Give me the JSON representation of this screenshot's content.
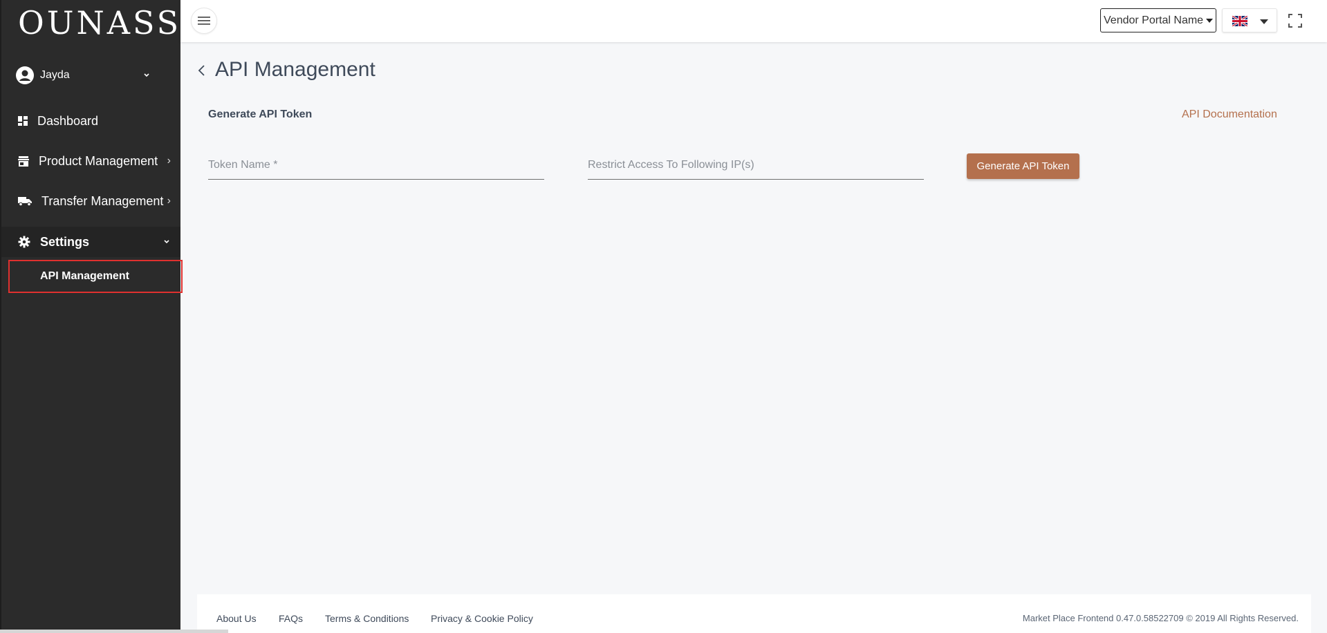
{
  "sidebar": {
    "logo": "OUNASS",
    "user": {
      "name": "Jayda"
    },
    "items": [
      {
        "label": "Dashboard",
        "icon": "dashboard-icon"
      },
      {
        "label": "Product Management",
        "icon": "store-icon"
      },
      {
        "label": "Transfer Management",
        "icon": "truck-icon"
      },
      {
        "label": "Settings",
        "icon": "gear-icon",
        "expanded": true
      }
    ],
    "sub_items": [
      {
        "label": "API Management",
        "highlighted": true
      }
    ]
  },
  "topbar": {
    "vendor_select": {
      "selected": "Vendor Portal Name"
    },
    "language_select": {
      "selected_icon": "uk-flag-icon"
    }
  },
  "main": {
    "title": "API Management",
    "section_title": "Generate API Token",
    "doc_link": "API Documentation",
    "token_name": {
      "placeholder": "Token Name *",
      "value": ""
    },
    "ip_restrict": {
      "placeholder": "Restrict Access To Following IP(s)",
      "value": ""
    },
    "generate_button": "Generate API Token"
  },
  "footer": {
    "links": [
      "About Us",
      "FAQs",
      "Terms & Conditions",
      "Privacy & Cookie Policy"
    ],
    "copyright": "Market Place Frontend 0.47.0.58522709 © 2019 All Rights Reserved."
  },
  "colors": {
    "sidebar_bg": "#2b2b2b",
    "accent": "#b4704d",
    "highlight_border": "#e0312f",
    "background": "#f6f7f9"
  }
}
